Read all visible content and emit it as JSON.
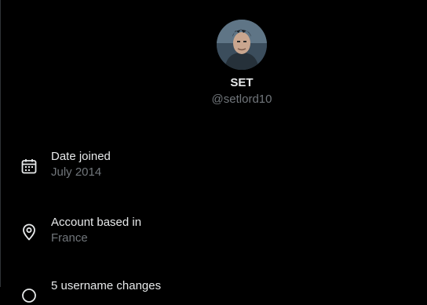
{
  "profile": {
    "display_name": "SET",
    "handle": "@setlord10"
  },
  "about": [
    {
      "icon": "calendar-icon",
      "label": "Date joined",
      "value": "July 2014"
    },
    {
      "icon": "location-pin-icon",
      "label": "Account based in",
      "value": "France"
    },
    {
      "icon": "username-history-icon",
      "label": "5 username changes",
      "value": ""
    }
  ],
  "colors": {
    "background": "#000000",
    "primary_text": "#e7e9ea",
    "secondary_text": "#71767b",
    "border": "#2f3336"
  }
}
